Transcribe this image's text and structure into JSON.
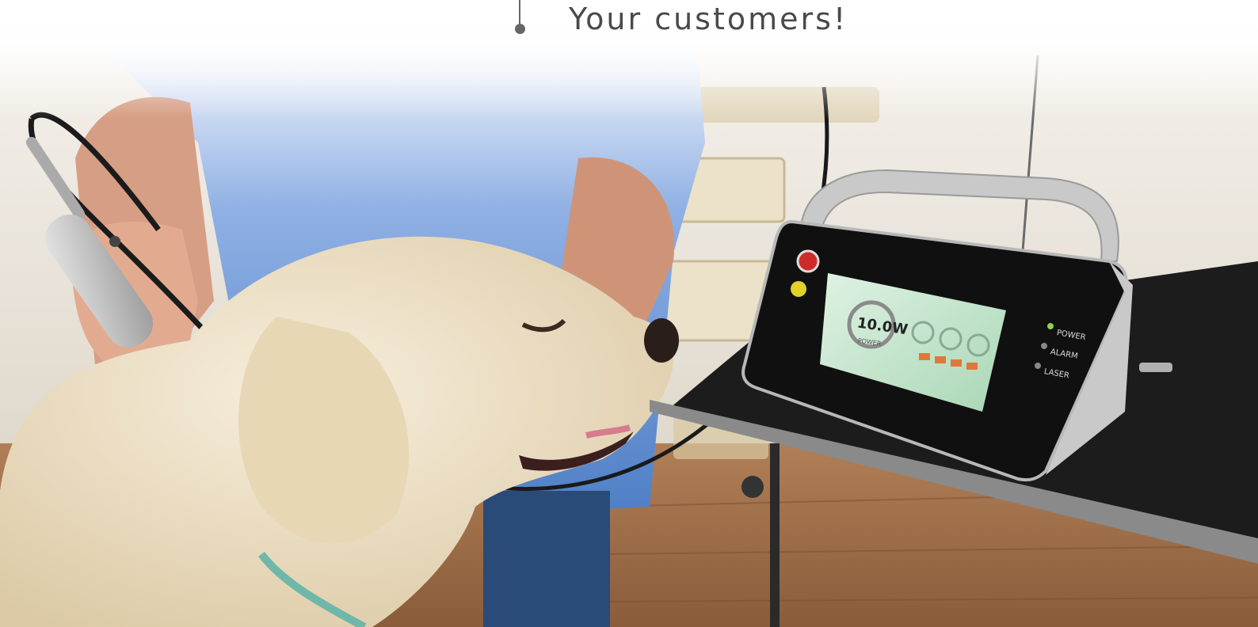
{
  "headline": {
    "text": "Your customers!"
  },
  "device": {
    "screen_power": "10.0W",
    "screen_subtext": "POWER",
    "indicators": [
      "POWER",
      "ALARM",
      "LASER"
    ]
  },
  "colors": {
    "wall": "#e9e3d8",
    "floor": "#9a6b46",
    "shirt": "#5f8fd0",
    "dog": "#efe3c9",
    "device_body": "#111111",
    "device_screen": "#c9e7cf",
    "table_top": "#1c1c1c"
  }
}
